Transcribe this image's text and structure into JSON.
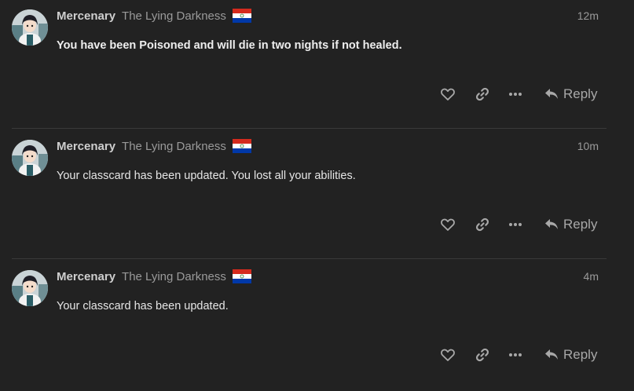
{
  "posts": [
    {
      "username": "Mercenary",
      "user_title": "The Lying Darkness",
      "flag_icon": "paraguay-flag-icon",
      "time": "12m",
      "text": "You have been Poisoned and will die in two nights if not healed.",
      "bold": true,
      "reply_label": "Reply"
    },
    {
      "username": "Mercenary",
      "user_title": "The Lying Darkness",
      "flag_icon": "paraguay-flag-icon",
      "time": "10m",
      "text": "Your classcard has been updated. You lost all your abilities.",
      "bold": false,
      "reply_label": "Reply"
    },
    {
      "username": "Mercenary",
      "user_title": "The Lying Darkness",
      "flag_icon": "paraguay-flag-icon",
      "time": "4m",
      "text": "Your classcard has been updated.",
      "bold": false,
      "reply_label": "Reply"
    }
  ],
  "colors": {
    "background": "#222222",
    "icon": "#a8a8a8",
    "divider": "#3a3a3a"
  }
}
